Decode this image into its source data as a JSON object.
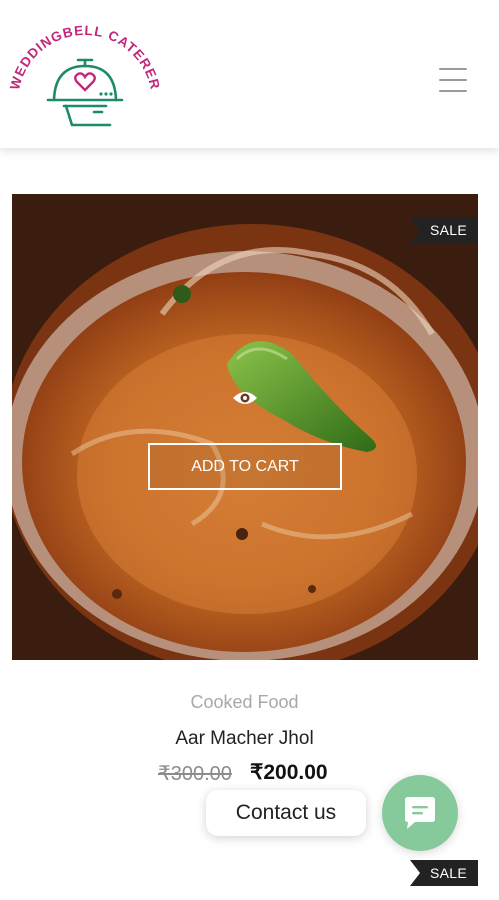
{
  "header": {
    "logo_text": "WEDDINGBELL CATERER",
    "menu_icon": "hamburger-menu-icon",
    "brand_color": "#c2277a",
    "logo_color": "#1e8a6a"
  },
  "product": {
    "sale_badge": "SALE",
    "add_to_cart_label": "ADD TO CART",
    "quick_view_icon": "eye-icon",
    "category": "Cooked Food",
    "name": "Aar Macher Jhol",
    "price_old": "₹300.00",
    "price_new": "₹200.00"
  },
  "next_product": {
    "sale_badge": "SALE"
  },
  "contact": {
    "label": "Contact us",
    "icon": "chat-icon",
    "button_color": "#86c99b"
  }
}
